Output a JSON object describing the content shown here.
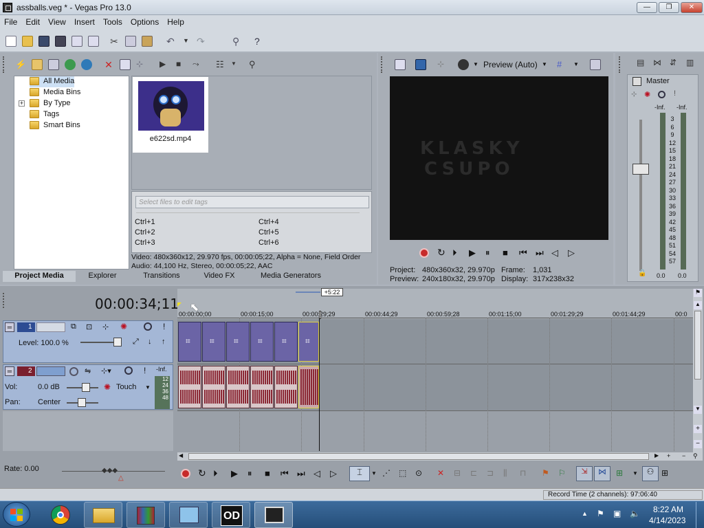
{
  "window": {
    "title": "assballs.veg * - Vegas Pro 13.0",
    "minimize": "—",
    "maximize": "❐",
    "close": "✕"
  },
  "menu": [
    "File",
    "Edit",
    "View",
    "Insert",
    "Tools",
    "Options",
    "Help"
  ],
  "media": {
    "tree": [
      "All Media",
      "Media Bins",
      "By Type",
      "Tags",
      "Smart Bins"
    ],
    "expand_glyph": "+",
    "file_name": "e622sd.mp4",
    "tags_placeholder": "Select files to edit tags",
    "shortcuts": [
      "Ctrl+1",
      "Ctrl+2",
      "Ctrl+3",
      "Ctrl+4",
      "Ctrl+5",
      "Ctrl+6"
    ],
    "info_video": "Video: 480x360x12, 29.970 fps, 00:00:05;22, Alpha = None, Field Order",
    "info_audio": "Audio: 44,100 Hz, Stereo, 00:00:05;22, AAC",
    "tabs": [
      "Project Media",
      "Explorer",
      "Transitions",
      "Video FX",
      "Media Generators"
    ]
  },
  "preview": {
    "mode": "Preview (Auto)",
    "frame_text1": "KLASKY",
    "frame_text2": "CSUPO",
    "project_label": "Project:",
    "project_value": "480x360x32, 29.970p",
    "preview_label": "Preview:",
    "preview_value": "240x180x32, 29.970p",
    "frame_label": "Frame:",
    "frame_value": "1,031",
    "display_label": "Display:",
    "display_value": "317x238x32"
  },
  "master": {
    "title": "Master",
    "inf_left": "-Inf.",
    "inf_right": "-Inf.",
    "scale": [
      "3",
      "6",
      "9",
      "12",
      "15",
      "18",
      "21",
      "24",
      "27",
      "30",
      "33",
      "36",
      "39",
      "42",
      "45",
      "48",
      "51",
      "54",
      "57"
    ],
    "bottom_left": "0.0",
    "bottom_right": "0.0"
  },
  "timeline": {
    "time": "00:00:34;11",
    "cursor_badge": "+5:22",
    "ruler": [
      "00:00:00;00",
      "00:00:15;00",
      "00:00:29;29",
      "00:00:44;29",
      "00:00:59;28",
      "00:01:15;00",
      "00:01:29;29",
      "00:01:44;29",
      "00:0"
    ],
    "video_track": {
      "number": "1",
      "level": "Level: 100.0 %"
    },
    "audio_track": {
      "number": "2",
      "vol_label": "Vol:",
      "vol_value": "0.0 dB",
      "pan_label": "Pan:",
      "pan_value": "Center",
      "automation": "Touch",
      "meter_inf": "-Inf.",
      "meter_scale": [
        "12",
        "24",
        "36",
        "48"
      ]
    },
    "rate": "Rate: 0.00",
    "record_time": "Record Time (2 channels): 97:06:40"
  },
  "taskbar": {
    "time": "8:22 AM",
    "date": "4/14/2023",
    "app_label": "OD"
  },
  "colors": {
    "video_clip": "#6b64a6",
    "audio_clip": "#d9c7c9",
    "waveform": "#8a2633",
    "track_header": "#7f9fcf"
  }
}
